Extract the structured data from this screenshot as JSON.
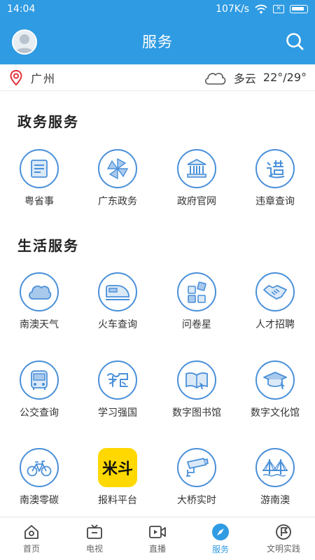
{
  "status": {
    "time": "14:04",
    "speed": "107K/s"
  },
  "header": {
    "title": "服务"
  },
  "weather": {
    "city": "广州",
    "condition": "多云",
    "temp": "22°/29°"
  },
  "sections": {
    "gov": {
      "title": "政务服务",
      "items": [
        {
          "label": "粤省事",
          "icon": "document-icon"
        },
        {
          "label": "广东政务",
          "icon": "pinwheel-icon"
        },
        {
          "label": "政府官网",
          "icon": "government-building-icon"
        },
        {
          "label": "违章查询",
          "icon": "violation-icon"
        }
      ]
    },
    "life": {
      "title": "生活服务",
      "items": [
        {
          "label": "南澳天气",
          "icon": "cloud-icon"
        },
        {
          "label": "火车查询",
          "icon": "train-icon"
        },
        {
          "label": "问卷星",
          "icon": "survey-icon"
        },
        {
          "label": "人才招聘",
          "icon": "handshake-icon"
        },
        {
          "label": "公交查询",
          "icon": "bus-icon"
        },
        {
          "label": "学习强国",
          "icon": "study-icon"
        },
        {
          "label": "数字图书馆",
          "icon": "book-icon"
        },
        {
          "label": "数字文化馆",
          "icon": "mortarboard-icon"
        },
        {
          "label": "南澳零碳",
          "icon": "bicycle-icon"
        },
        {
          "label": "报料平台",
          "icon": "report-logo",
          "logo_text": "米斗"
        },
        {
          "label": "大桥实时",
          "icon": "camera-icon"
        },
        {
          "label": "游南澳",
          "icon": "bridge-icon"
        }
      ]
    }
  },
  "tabs": [
    {
      "label": "首页",
      "icon": "home-icon"
    },
    {
      "label": "电视",
      "icon": "tv-icon"
    },
    {
      "label": "直播",
      "icon": "live-video-icon"
    },
    {
      "label": "服务",
      "icon": "compass-icon",
      "active": true
    },
    {
      "label": "文明实践",
      "icon": "flag-circle-icon"
    }
  ],
  "colors": {
    "primary": "#2f9be3",
    "icon_stroke": "#4a90d9",
    "tile_yellow": "#ffd800"
  }
}
